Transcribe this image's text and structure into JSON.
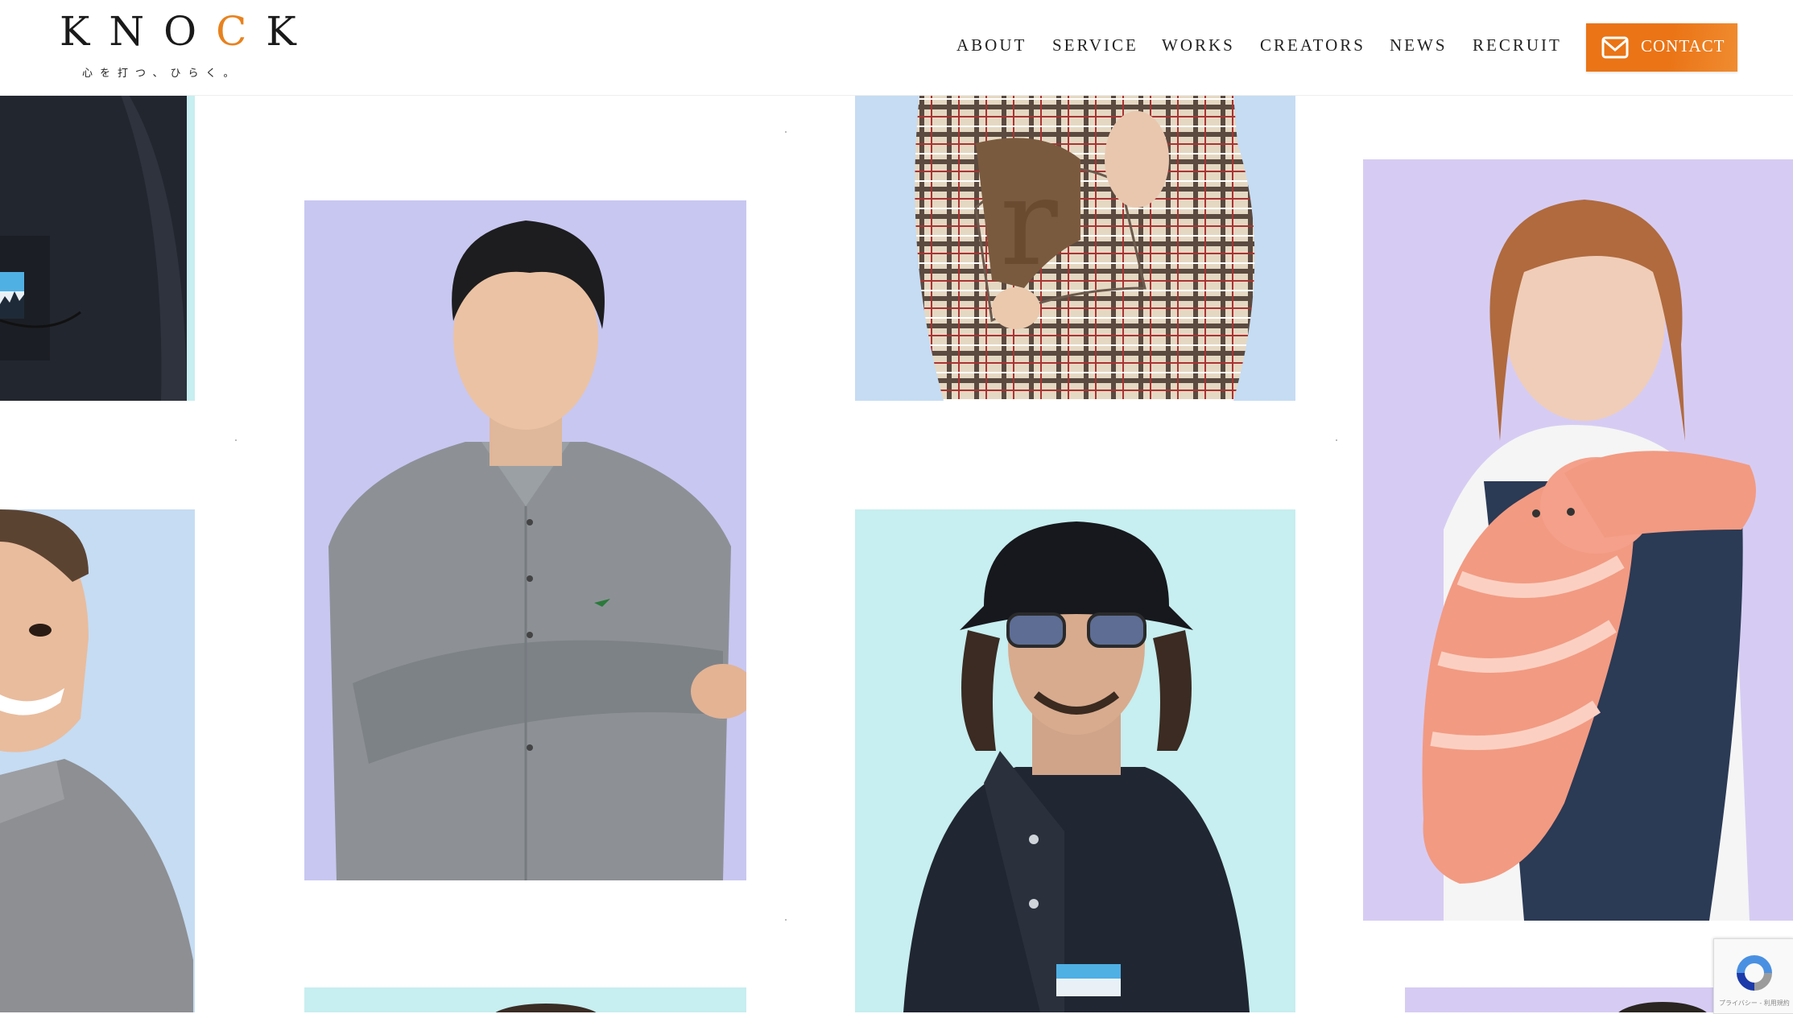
{
  "brand": {
    "logo_prefix": "KNO",
    "logo_accent": "C",
    "logo_suffix": "K",
    "tagline": "心を打つ、ひらく。"
  },
  "nav": {
    "items": [
      "ABOUT",
      "SERVICE",
      "WORKS",
      "CREATORS",
      "NEWS",
      "RECRUIT"
    ],
    "contact_label": "CONTACT"
  },
  "recaptcha": {
    "footer_text": "プライバシー - 利用規約"
  },
  "colors": {
    "accent": "#ea7416",
    "card_lavender": "#c8c7f1",
    "card_blue": "#c5dcf3",
    "card_cyan": "#c7eef0",
    "card_violet": "#d6ccf3"
  }
}
